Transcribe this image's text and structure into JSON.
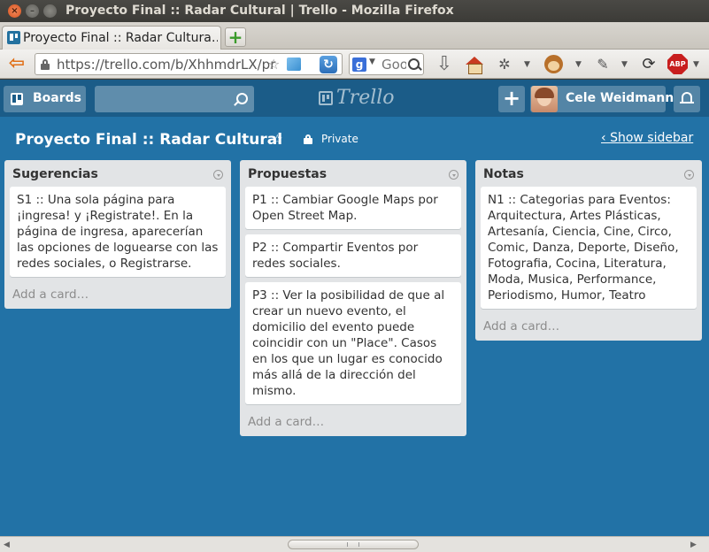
{
  "window": {
    "title": "Proyecto Final :: Radar Cultural | Trello - Mozilla Firefox"
  },
  "tabs": [
    {
      "title": "Proyecto Final :: Radar Cultura…"
    }
  ],
  "navbar": {
    "url": "https://trello.com/b/XhhmdrLX/pr",
    "search_placeholder": "Goo"
  },
  "header": {
    "boards_label": "Boards",
    "logo_text": "Trello",
    "add_label": "+",
    "member_name": "Cele Weidmann"
  },
  "board": {
    "title": "Proyecto Final :: Radar Cultural",
    "visibility": "Private",
    "show_sidebar": "Show sidebar"
  },
  "lists": [
    {
      "title": "Sugerencias",
      "cards": [
        "S1 :: Una sola página para ¡ingresa! y ¡Registrate!. En la página de ingresa, aparecerían las opciones de loguearse con las redes sociales, o Registrarse."
      ],
      "add_card": "Add a card…"
    },
    {
      "title": "Propuestas",
      "cards": [
        "P1 :: Cambiar Google Maps por Open Street Map.",
        "P2 :: Compartir Eventos por redes sociales.",
        "P3 :: Ver la posibilidad de que al crear un nuevo evento, el domicilio del evento puede coincidir con un \"Place\". Casos en los que un lugar es conocido más allá de la dirección del mismo."
      ],
      "add_card": "Add a card…"
    },
    {
      "title": "Notas",
      "cards": [
        "N1 :: Categorias para Eventos: Arquitectura, Artes Plásticas, Artesanía, Ciencia, Cine, Circo, Comic, Danza, Deporte, Diseño, Fotografia, Cocina, Literatura, Moda, Musica, Performance, Periodismo, Humor, Teatro"
      ],
      "add_card": "Add a card…"
    }
  ],
  "colors": {
    "board_background": "#2272a6",
    "header_background": "#1b5c88",
    "list_background": "#e2e4e6"
  }
}
